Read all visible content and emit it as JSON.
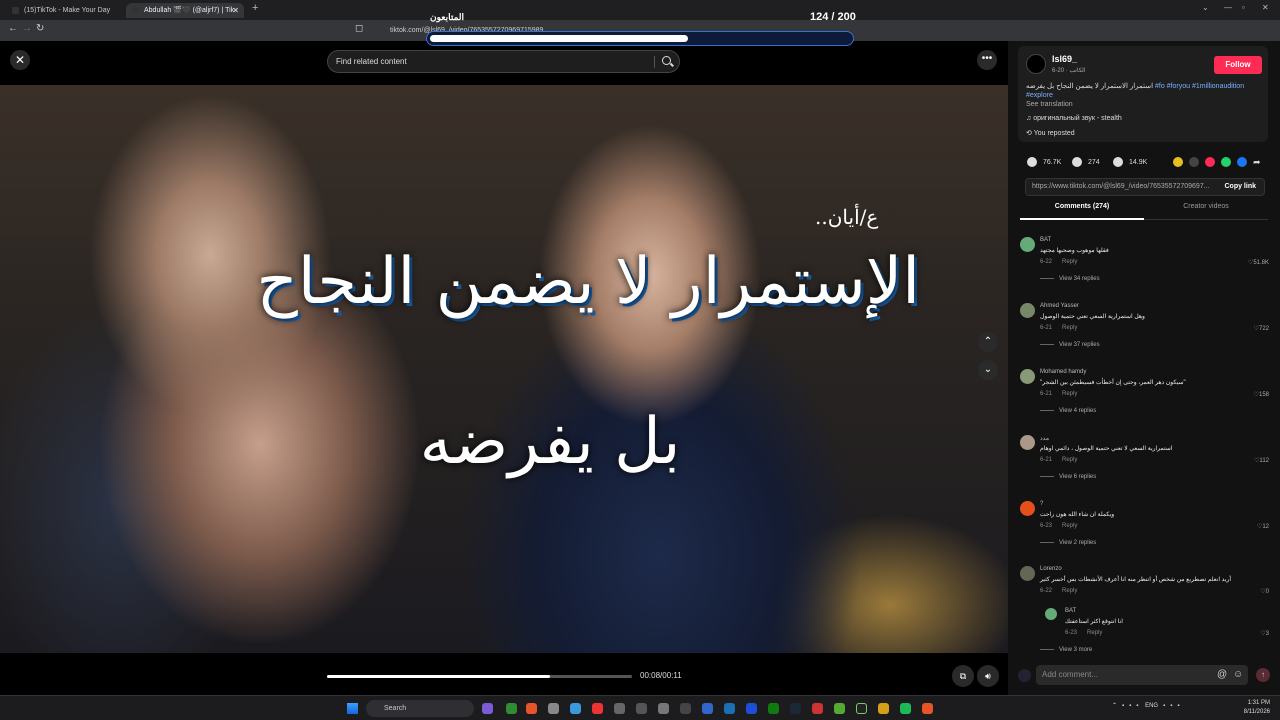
{
  "browser": {
    "tabs": [
      {
        "title": "(15)TikTok - Make Your Day"
      },
      {
        "title": "Abdullah 🎬🖤 (@aljrf7) | Tik"
      }
    ],
    "address": "tiktok.com/@lsl69_/video/7653557270969715989",
    "overlay": {
      "name": "المتابعون",
      "count": "124 / 200",
      "progress": 0.62
    }
  },
  "video": {
    "search_placeholder": "Find related content",
    "caption_signature": "ع/أيان..",
    "caption_line1": "الإستمرار لا يضمن النجاح",
    "caption_line2": "بل يفرضه",
    "time": "00:08/00:11",
    "progress": 0.73
  },
  "author": {
    "name": "lsl69_",
    "sub": "6-20 · الكاتب",
    "follow_label": "Follow",
    "description": "استمرار الاستمرار لا يضمن النجاح بل يفرضه",
    "hashtags": "#fo #foryou #1millionaudition #explore",
    "see_translation": "See translation",
    "music": "оригинальный звук - stealth",
    "reposted": "You reposted"
  },
  "stats": {
    "likes": "76.7K",
    "comments": "274",
    "saves": "14.9K"
  },
  "link": {
    "url": "https://www.tiktok.com/@lsl69_/video/76535572709697...",
    "copy_label": "Copy link"
  },
  "tabs": {
    "comments": "Comments (274)",
    "creator": "Creator videos"
  },
  "comments": [
    {
      "name": "BAT",
      "text": "فقلها موهوب وصحبها مجتهد",
      "date": "6-22",
      "reply": "Reply",
      "likes": "51.8K",
      "view": "View 34 replies"
    },
    {
      "name": "Ahmed Yasser",
      "text": "وهل استمرارية السعي تعني حتمية الوصول",
      "date": "6-21",
      "reply": "Reply",
      "likes": "722",
      "view": "View 37 replies"
    },
    {
      "name": "Mohamed hamdy",
      "text": "\"سيكون دهر العمر، وحتى إن أخطأت فسيطمئن بين الشجر\"",
      "date": "6-21",
      "reply": "Reply",
      "likes": "158",
      "view": "View 4 replies"
    },
    {
      "name": "مدد",
      "text": "استمرارية السعي لا تعني حتمية الوصول ، دائمي اوهام",
      "date": "6-21",
      "reply": "Reply",
      "likes": "112",
      "view": "View 6 replies"
    },
    {
      "name": "?",
      "text": "ويكملة ان شاء الله هون راحت",
      "date": "6-23",
      "reply": "Reply",
      "likes": "12",
      "view": "View 2 replies"
    },
    {
      "name": "Lorenzo",
      "text": "أريد انعلم تصطربع من شخص أو انتظر منه انا أعرف الأنشطات بس أخسر كثير",
      "date": "6-22",
      "reply": "Reply",
      "likes": "0"
    }
  ],
  "nested_reply": {
    "name": "BAT",
    "text": "انا انتوقع اكثر استاعفتك",
    "date": "6-23",
    "reply": "Reply",
    "likes": "3",
    "view": "View 3 more"
  },
  "comment_input": {
    "placeholder": "Add comment..."
  },
  "taskbar": {
    "search": "Search",
    "lang": "ENG",
    "time": "1:31 PM",
    "date": "8/11/2026"
  }
}
